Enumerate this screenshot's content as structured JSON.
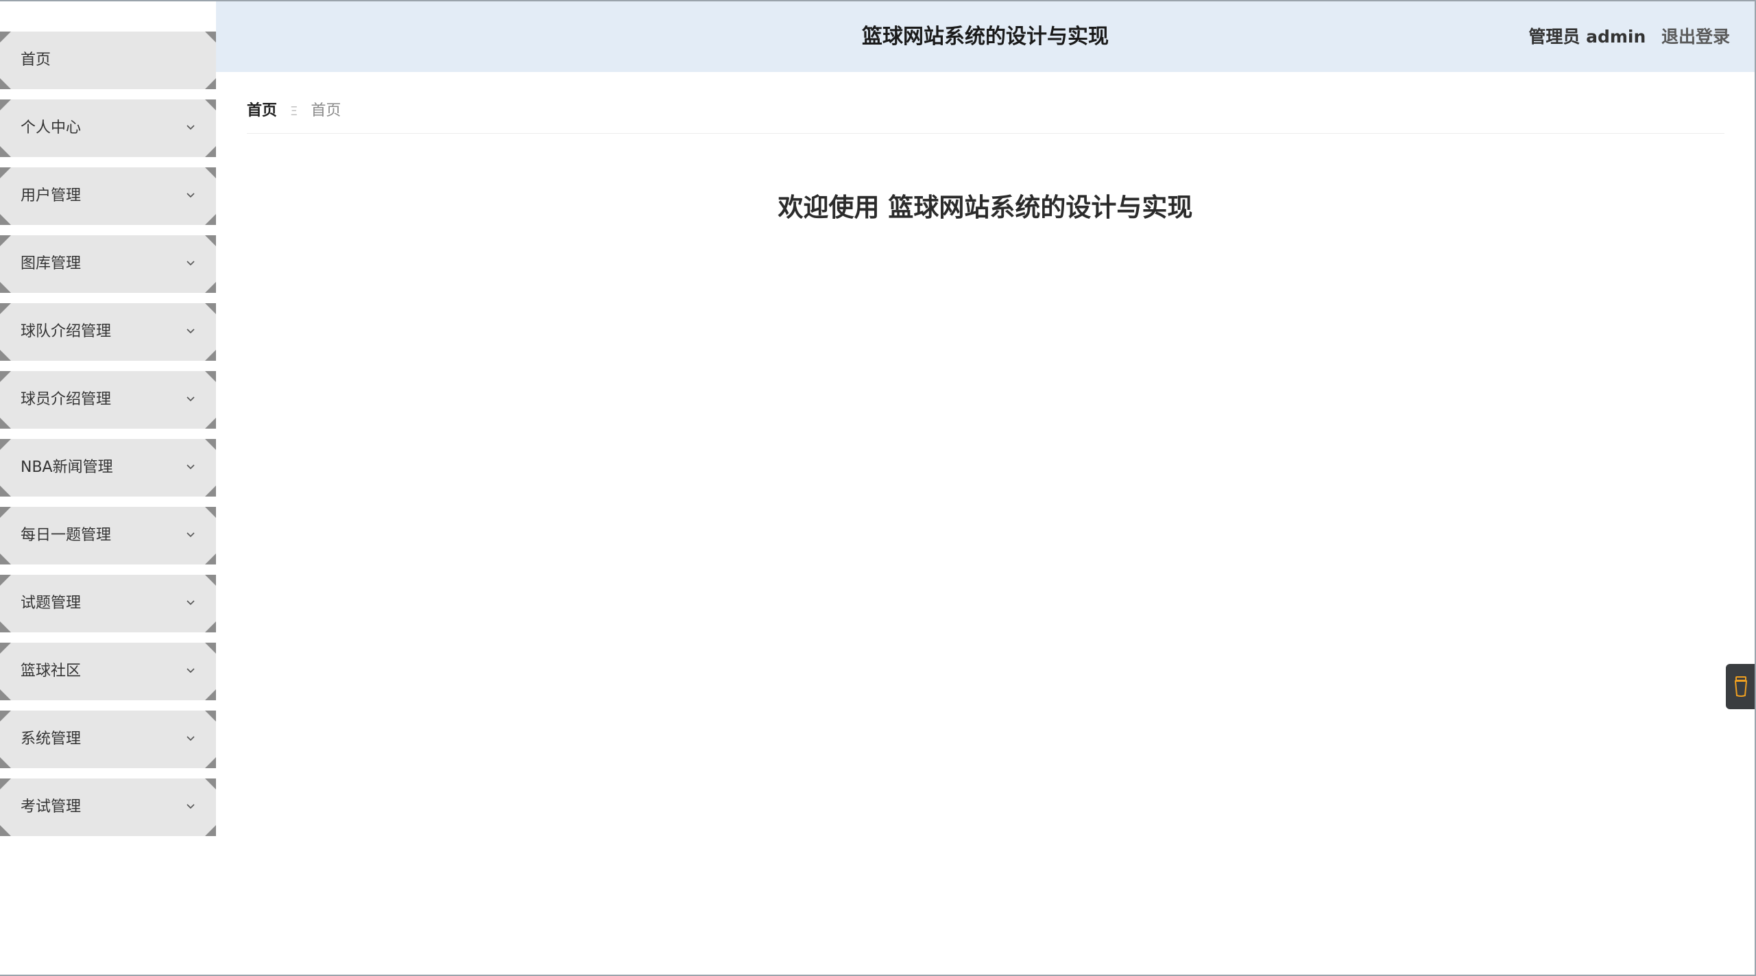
{
  "header": {
    "title": "篮球网站系统的设计与实现",
    "user_label": "管理员 admin",
    "logout_label": "退出登录"
  },
  "sidebar": {
    "items": [
      {
        "label": "首页",
        "has_submenu": false
      },
      {
        "label": "个人中心",
        "has_submenu": true
      },
      {
        "label": "用户管理",
        "has_submenu": true
      },
      {
        "label": "图库管理",
        "has_submenu": true
      },
      {
        "label": "球队介绍管理",
        "has_submenu": true
      },
      {
        "label": "球员介绍管理",
        "has_submenu": true
      },
      {
        "label": "NBA新闻管理",
        "has_submenu": true
      },
      {
        "label": "每日一题管理",
        "has_submenu": true
      },
      {
        "label": "试题管理",
        "has_submenu": true
      },
      {
        "label": "篮球社区",
        "has_submenu": true
      },
      {
        "label": "系统管理",
        "has_submenu": true
      },
      {
        "label": "考试管理",
        "has_submenu": true
      }
    ]
  },
  "breadcrumb": {
    "home": "首页",
    "separator": "Ξ",
    "current": "首页"
  },
  "main": {
    "welcome": "欢迎使用 篮球网站系统的设计与实现"
  },
  "colors": {
    "header_bg": "#e3ecf6",
    "menu_bg": "#e6e6e6",
    "menu_corner": "#8c8c8c",
    "widget_bg": "#3a3d40",
    "widget_icon": "#f0a020"
  },
  "icons": {
    "menu_chevron": "chevron-down-icon",
    "float_widget": "cup-icon"
  }
}
